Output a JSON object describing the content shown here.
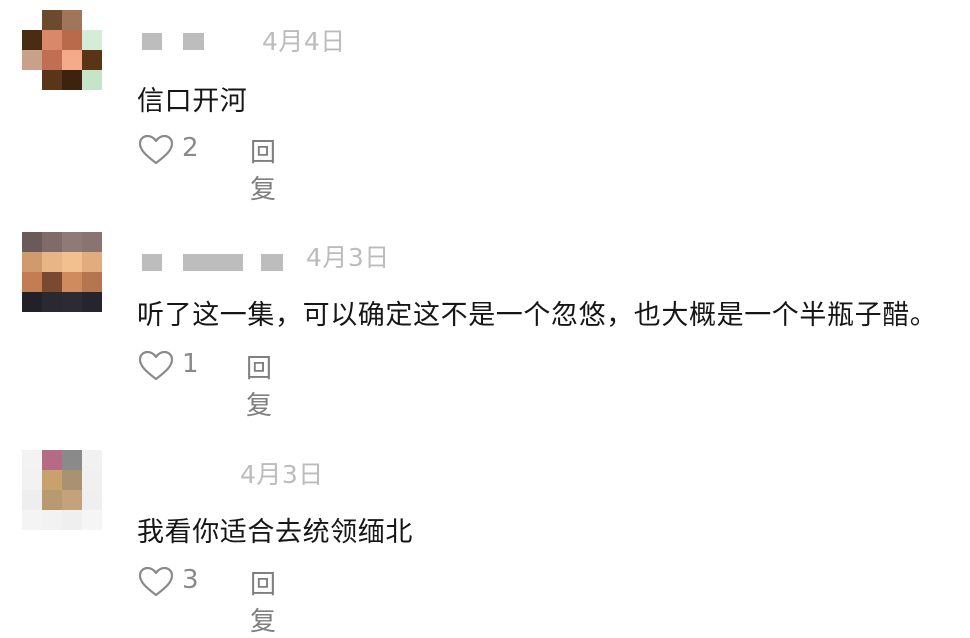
{
  "comments": [
    {
      "date": "4月4日",
      "text": "信口开河",
      "likes": "2",
      "reply_label": "回复",
      "avatar_colors": [
        "#ffffff",
        "#6b4a2d",
        "#a0765a",
        "#ffffff",
        "#4a2c12",
        "#d9896a",
        "#b86a4a",
        "#d5ecd6",
        "#c9a08a",
        "#c06f52",
        "#f3ab8a",
        "#5a3416",
        "#ffffff",
        "#5a3518",
        "#3d2210",
        "#c6e4c8"
      ]
    },
    {
      "date": "4月3日",
      "text": "听了这一集，可以确定这不是一个忽悠，也大概是一个半瓶子醋。",
      "likes": "1",
      "reply_label": "回复",
      "avatar_colors": [
        "#6a5b5a",
        "#7f6b6a",
        "#8f7a78",
        "#8a7472",
        "#d09a6c",
        "#e8b585",
        "#f2bf8e",
        "#e3ac7e",
        "#c47d52",
        "#7a4a30",
        "#cf8a5d",
        "#b5754f",
        "#232128",
        "#2a2830",
        "#2c2a32",
        "#26242c"
      ]
    },
    {
      "date": "4月3日",
      "text": "我看你适合去统领缅北",
      "likes": "3",
      "reply_label": "回复",
      "avatar_colors": [
        "#f3f3f3",
        "#b56a86",
        "#8a8a8a",
        "#f1f1f1",
        "#f2f2f2",
        "#c7a36b",
        "#a89272",
        "#f0f0f0",
        "#eeeeee",
        "#b99a70",
        "#c4a27a",
        "#efefef",
        "#f4f4f4",
        "#f2f2f2",
        "#efefef",
        "#f5f5f5"
      ]
    }
  ]
}
